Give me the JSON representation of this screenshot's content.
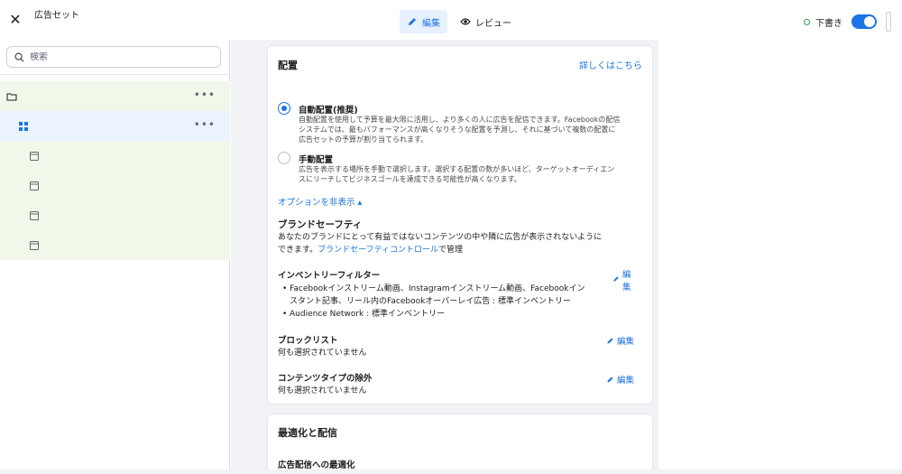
{
  "topbar": {
    "title": "広告セット",
    "tabs": [
      {
        "label": "編集",
        "icon": "pencil-icon",
        "active": true
      },
      {
        "label": "レビュー",
        "icon": "eye-icon",
        "active": false
      }
    ],
    "status_label": "下書き",
    "status_color": "#31a24c"
  },
  "sidebar": {
    "search_placeholder": "検索",
    "items": [
      {
        "icon": "folder-icon",
        "level": 0
      },
      {
        "icon": "grid-icon",
        "level": 1,
        "selected": true
      },
      {
        "icon": "ad-icon",
        "level": 2
      },
      {
        "icon": "ad-icon",
        "level": 2
      },
      {
        "icon": "ad-icon",
        "level": 2
      },
      {
        "icon": "ad-icon",
        "level": 2
      }
    ]
  },
  "placement": {
    "title": "配置",
    "learn_more": "詳しくはこちら",
    "auto": {
      "title": "自動配置(推奨)",
      "desc_lines": [
        "自動配置を使用して予算を最大限に活用し、より多くの人に広告を配信できます。Facebookの配信",
        "システムでは、最もパフォーマンスが高くなりそうな配置を予測し、それに基づいて複数の配置に",
        "広告セットの予算が割り当てられます。"
      ],
      "selected": true
    },
    "manual": {
      "title": "手動配置",
      "desc_lines": [
        "広告を表示する場所を手動で選択します。選択する配置の数が多いほど、ターゲットオーディエン",
        "スにリーチしてビジネスゴールを達成できる可能性が高くなります。"
      ],
      "selected": false
    },
    "hide_options": "オプションを非表示 ▴"
  },
  "brand_safety": {
    "title": "ブランドセーフティ",
    "desc_line1": "あなたのブランドにとって有益ではないコンテンツの中や隣に広告が表示されないように",
    "desc_line2_prefix": "できます。",
    "desc_link": "ブランドセーフティコントロール",
    "desc_line2_suffix": "で管理",
    "inventory": {
      "title": "インベントリーフィルター",
      "bullets": [
        "Facebookインストリーム動画、Instagramインストリーム動画、Facebookイン",
        "スタント記事、リール内のFacebookオーバーレイ広告 : 標準インベントリー",
        "Audience Network : 標準インベントリー"
      ],
      "edit_char1": "編",
      "edit_char2": "集"
    },
    "blocklist": {
      "title": "ブロックリスト",
      "value": "何も選択されていません",
      "edit": "編集"
    },
    "content_exclusion": {
      "title": "コンテンツタイプの除外",
      "value": "何も選択されていません",
      "edit": "編集"
    }
  },
  "optimization": {
    "title": "最適化と配信",
    "subtitle": "広告配信への最適化"
  },
  "colors": {
    "accent": "#1b74e4",
    "tree_bg": "#f1f8e9",
    "selected_bg": "#ebf3fd"
  }
}
